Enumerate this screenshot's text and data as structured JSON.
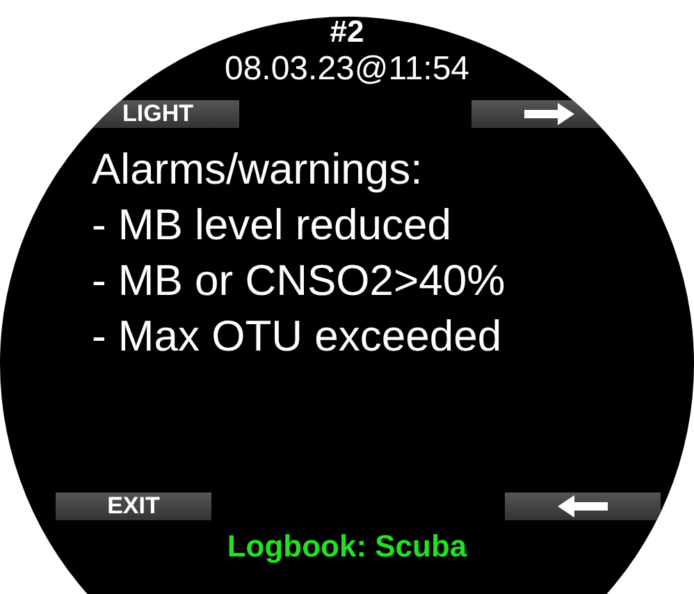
{
  "header": {
    "number": "#2",
    "datetime": "08.03.23@11:54"
  },
  "top_softkeys": {
    "left": "LIGHT"
  },
  "title": "Alarms/warnings:",
  "items": [
    "- MB level reduced",
    "- MB or CNSO2>40%",
    "- Max OTU exceeded"
  ],
  "bottom_softkeys": {
    "left": "EXIT"
  },
  "footer": "Logbook: Scuba"
}
